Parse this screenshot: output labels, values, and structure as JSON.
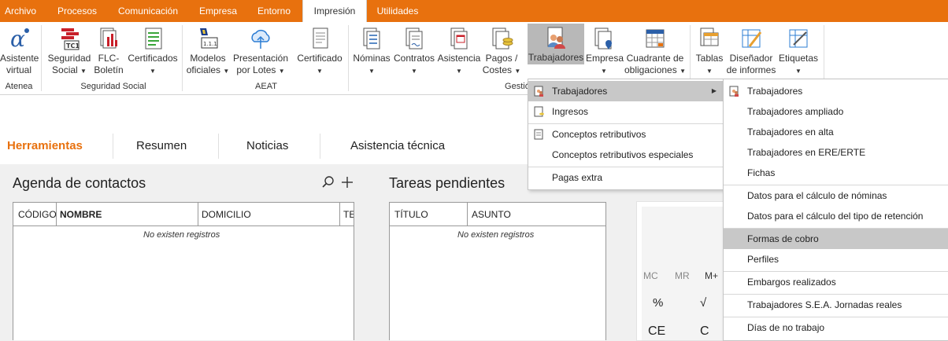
{
  "menubar": {
    "tabs": [
      "Archivo",
      "Procesos",
      "Comunicación",
      "Empresa",
      "Entorno",
      "Impresión",
      "Utilidades"
    ],
    "active": "Impresión"
  },
  "ribbon": {
    "buttons": {
      "asistente": [
        "Asistente",
        "virtual"
      ],
      "seguridad": [
        "Seguridad",
        "Social"
      ],
      "flc": [
        "FLC-",
        "Boletín"
      ],
      "certificados": [
        "Certificados",
        ""
      ],
      "modelos": [
        "Modelos",
        "oficiales"
      ],
      "presentacion": [
        "Presentación",
        "por Lotes"
      ],
      "certificado": [
        "Certificado",
        ""
      ],
      "nominas": [
        "Nóminas",
        ""
      ],
      "contratos": [
        "Contratos",
        ""
      ],
      "asistencia": [
        "Asistencia",
        ""
      ],
      "pagos": [
        "Pagos /",
        "Costes"
      ],
      "trabajadores": [
        "Trabajadores",
        ""
      ],
      "empresa": [
        "Empresa",
        ""
      ],
      "cuadrante": [
        "Cuadrante de",
        "obligaciones"
      ],
      "tablas": [
        "Tablas",
        ""
      ],
      "disenador": [
        "Diseñador",
        "de informes"
      ],
      "etiquetas": [
        "Etiquetas",
        ""
      ]
    },
    "groups": {
      "atenea": "Atenea",
      "seguridad": "Seguridad Social",
      "aeat": "AEAT",
      "gestion": "Gestión"
    },
    "tc_icon_text": "TC1",
    "aeat_icon_text": "1.1.1"
  },
  "nav": {
    "tabs": [
      "Herramientas",
      "Resumen",
      "Noticias",
      "Asistencia técnica"
    ],
    "active": "Herramientas"
  },
  "agenda": {
    "title": "Agenda de contactos",
    "columns": [
      "CÓDIGO",
      "NOMBRE",
      "DOMICILIO",
      "TE"
    ],
    "empty": "No existen registros"
  },
  "tareas": {
    "title": "Tareas pendientes",
    "columns": [
      "TÍTULO",
      "ASUNTO"
    ],
    "empty": "No existen registros"
  },
  "calculator": {
    "memory": [
      "MC",
      "MR",
      "M+"
    ],
    "row1": [
      "%",
      "√"
    ],
    "row2": [
      "CE",
      "C"
    ]
  },
  "submenu1": {
    "items": [
      "Trabajadores",
      "Ingresos",
      "Conceptos retributivos",
      "Conceptos retributivos especiales",
      "Pagas extra"
    ],
    "highlighted": "Trabajadores"
  },
  "submenu2": {
    "items": [
      "Trabajadores",
      "Trabajadores ampliado",
      "Trabajadores en alta",
      "Trabajadores en ERE/ERTE",
      "Fichas",
      "Datos para el cálculo de nóminas",
      "Datos para el cálculo del tipo de retención",
      "Formas de cobro",
      "Perfiles",
      "Embargos realizados",
      "Trabajadores S.E.A. Jornadas reales",
      "Días de no trabajo"
    ],
    "highlighted": "Formas de cobro"
  },
  "colors": {
    "accent": "#e8710e",
    "highlight": "#c8c8c8"
  }
}
